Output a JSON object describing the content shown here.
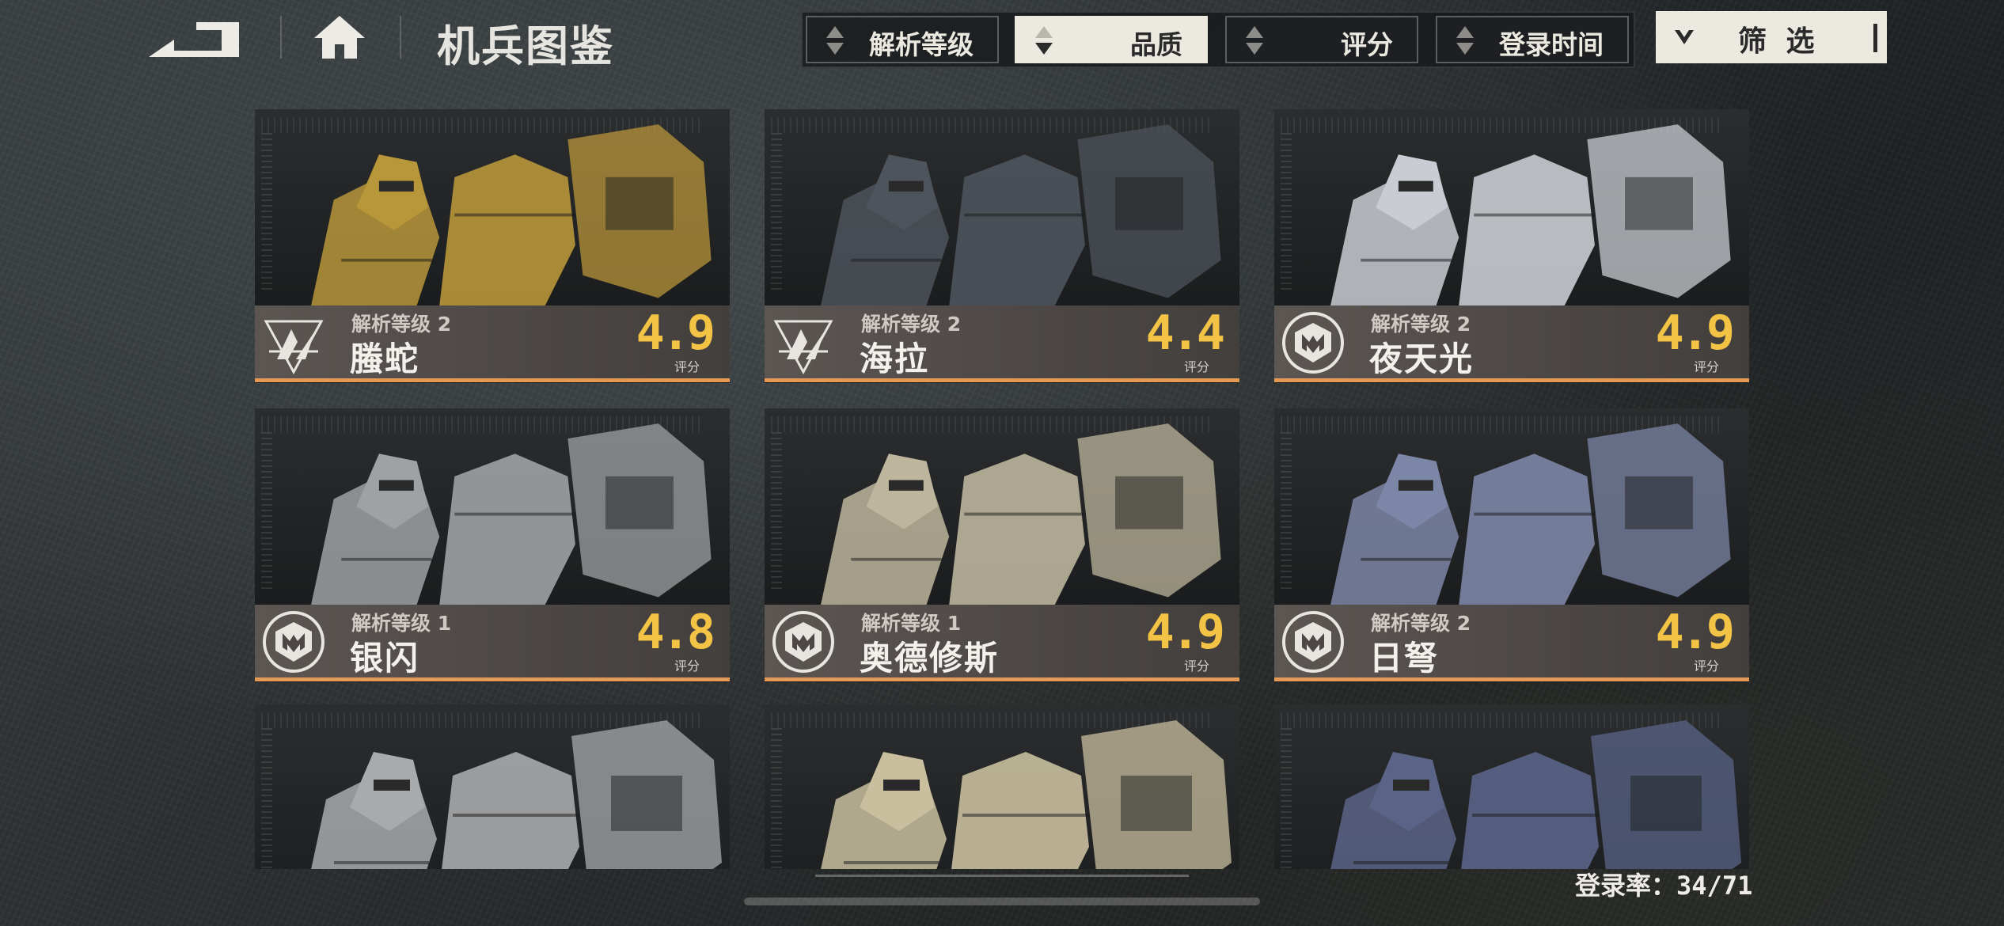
{
  "header": {
    "title": "机兵图鉴"
  },
  "sort": {
    "options": [
      {
        "label": "解析等级",
        "active": false
      },
      {
        "label": "品质",
        "active": true
      },
      {
        "label": "评分",
        "active": false
      },
      {
        "label": "登录时间",
        "active": false
      }
    ],
    "filter_label": "筛 选"
  },
  "cards": [
    {
      "level": "解析等级 2",
      "name": "螣蛇",
      "score": "4.9",
      "score_label": "评分",
      "emblem": "delta-triangle-icon",
      "palette": "#b8963a"
    },
    {
      "level": "解析等级 2",
      "name": "海拉",
      "score": "4.4",
      "score_label": "评分",
      "emblem": "delta-triangle-icon",
      "palette": "#4e545c"
    },
    {
      "level": "解析等级 2",
      "name": "夜天光",
      "score": "4.9",
      "score_label": "评分",
      "emblem": "m-shield-icon",
      "palette": "#c9ccd2"
    },
    {
      "level": "解析等级 1",
      "name": "银闪",
      "score": "4.8",
      "score_label": "评分",
      "emblem": "m-shield-icon",
      "palette": "#9fa2a4"
    },
    {
      "level": "解析等级 1",
      "name": "奥德修斯",
      "score": "4.9",
      "score_label": "评分",
      "emblem": "m-shield-icon",
      "palette": "#bdb59c"
    },
    {
      "level": "解析等级 2",
      "name": "日弩",
      "score": "4.9",
      "score_label": "评分",
      "emblem": "m-shield-icon",
      "palette": "#7c86a6"
    },
    {
      "palette": "#a8aaac"
    },
    {
      "palette": "#c9bf9f"
    },
    {
      "palette": "#5a6487"
    }
  ],
  "footer": {
    "record_label": "登录率：",
    "record_value": "34/71"
  },
  "colors": {
    "accent_orange": "#e39a57",
    "score_yellow": "#f2c344",
    "active_sort_bg": "#ece9e1"
  }
}
